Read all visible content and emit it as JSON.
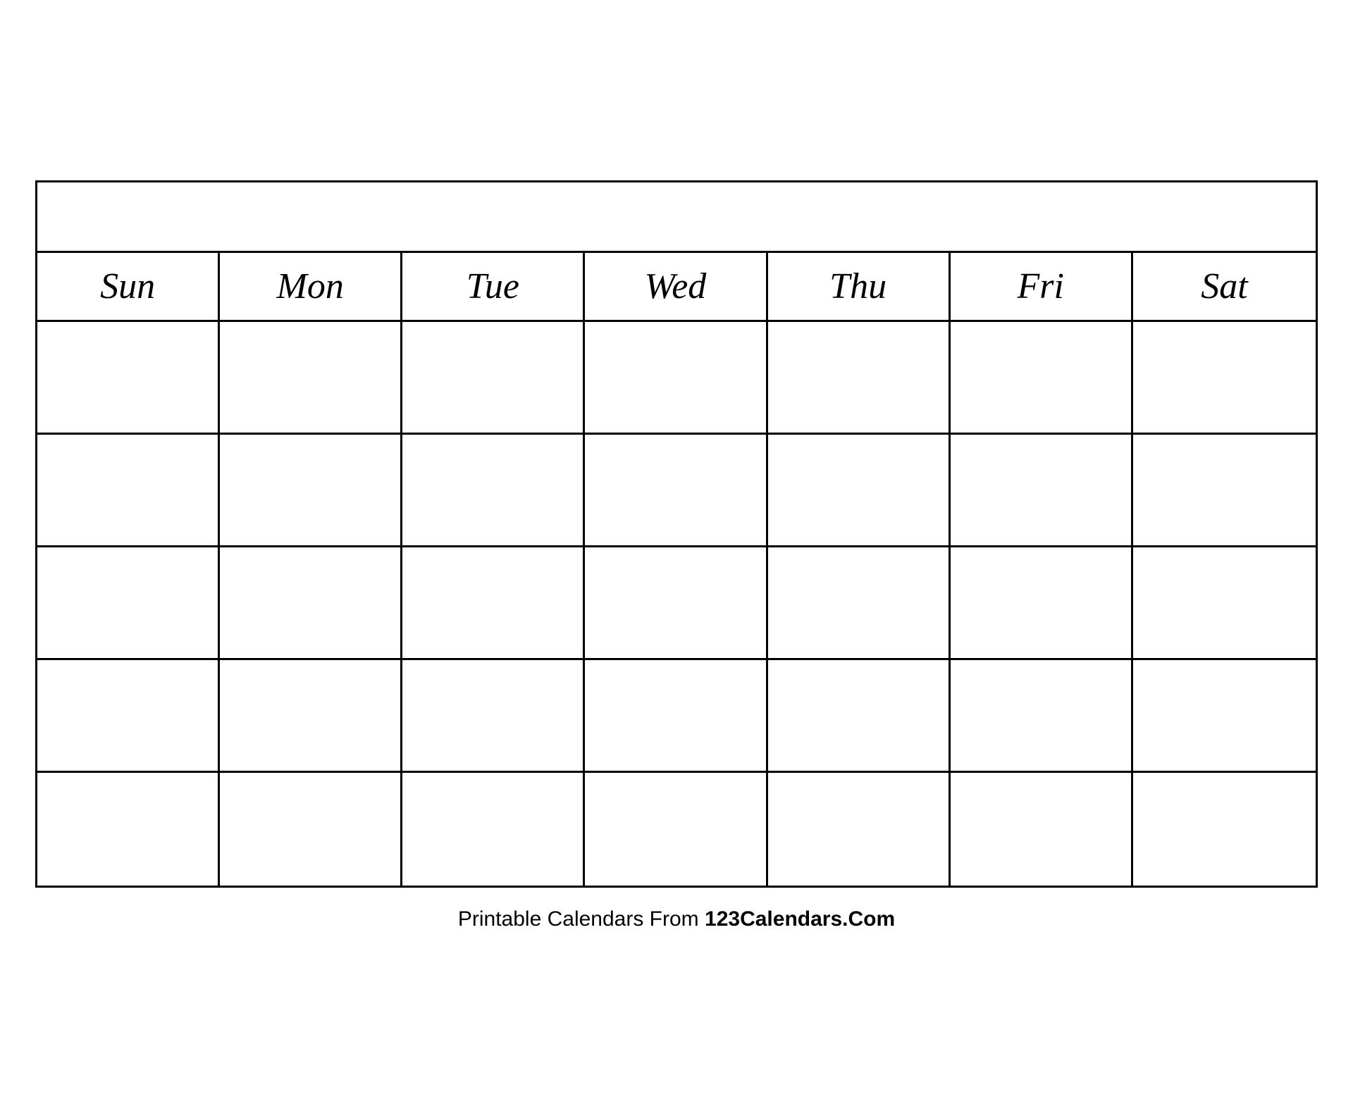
{
  "calendar": {
    "header_row_title": "",
    "days": [
      {
        "label": "Sun"
      },
      {
        "label": "Mon"
      },
      {
        "label": "Tue"
      },
      {
        "label": "Wed"
      },
      {
        "label": "Thu"
      },
      {
        "label": "Fri"
      },
      {
        "label": "Sat"
      }
    ],
    "rows": 5,
    "cols": 7
  },
  "footer": {
    "prefix": "Printable Calendars From ",
    "brand": "123Calendars.Com"
  }
}
